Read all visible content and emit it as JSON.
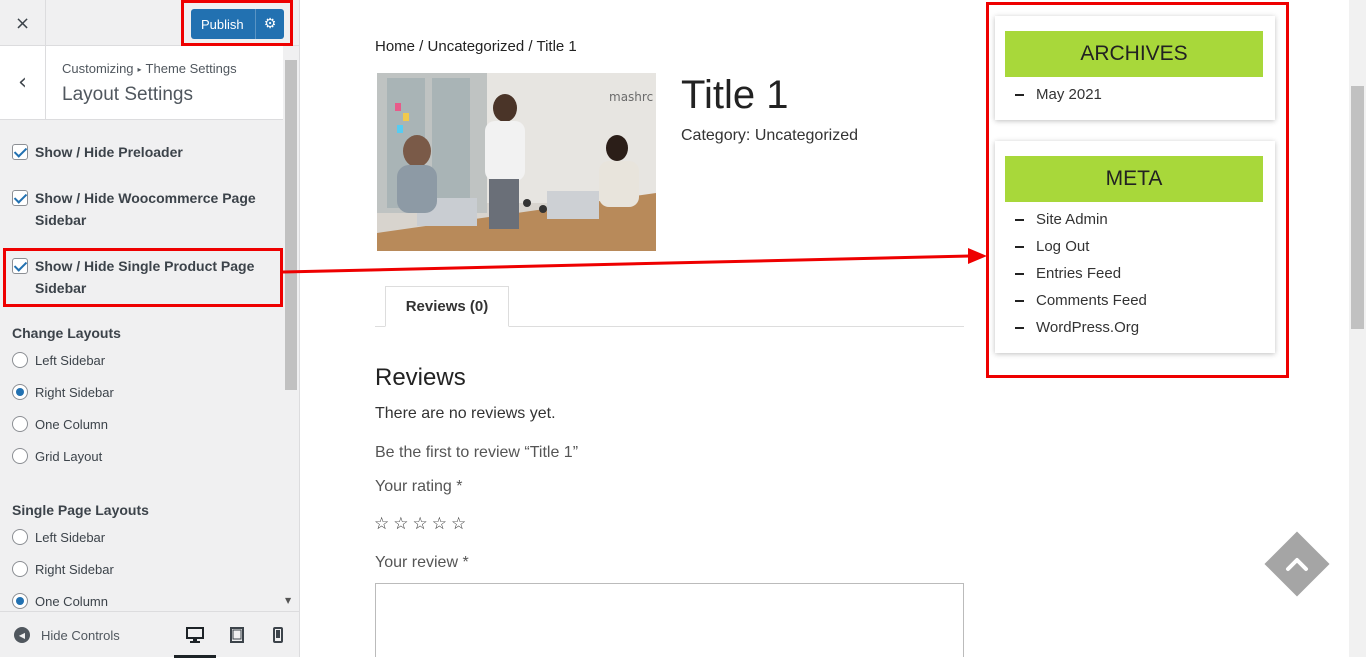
{
  "customizer": {
    "close_icon": "×",
    "publish_label": "Publish",
    "breadcrumb_parent": "Customizing",
    "breadcrumb_section": "Theme Settings",
    "section_title": "Layout Settings",
    "checkboxes": [
      {
        "label": "Show / Hide Preloader",
        "checked": true
      },
      {
        "label": "Show / Hide Woocommerce Page Sidebar",
        "checked": true
      },
      {
        "label": "Show / Hide Single Product Page Sidebar",
        "checked": true
      }
    ],
    "change_layouts": {
      "title": "Change Layouts",
      "options": [
        "Left Sidebar",
        "Right Sidebar",
        "One Column",
        "Grid Layout"
      ],
      "selected": "Right Sidebar"
    },
    "single_page_layouts": {
      "title": "Single Page Layouts",
      "options": [
        "Left Sidebar",
        "Right Sidebar",
        "One Column"
      ],
      "selected": "One Column"
    },
    "footer": {
      "hide_controls": "Hide Controls",
      "devices": [
        "desktop-icon",
        "tablet-icon",
        "mobile-icon"
      ],
      "active_device": "desktop"
    }
  },
  "preview": {
    "breadcrumb": "Home / Uncategorized / Title 1",
    "product_title": "Title 1",
    "category_label": "Category:",
    "category_value": "Uncategorized",
    "tab_reviews": "Reviews (0)",
    "reviews_heading": "Reviews",
    "no_reviews": "There are no reviews yet.",
    "be_first": "Be the first to review “Title 1”",
    "your_rating": "Your rating *",
    "star_count": 5,
    "your_review": "Your review *",
    "image_watermark": "mashrc"
  },
  "widgets": {
    "archives": {
      "title": "ARCHIVES",
      "items": [
        "May 2021"
      ]
    },
    "meta": {
      "title": "META",
      "items": [
        "Site Admin",
        "Log Out",
        "Entries Feed",
        "Comments Feed",
        "WordPress.Org"
      ]
    }
  },
  "colors": {
    "accent_blue": "#2271b1",
    "highlight_red": "#ee0000",
    "widget_green": "#a8d83a",
    "scroll_top_grey": "#a5a5a5"
  }
}
